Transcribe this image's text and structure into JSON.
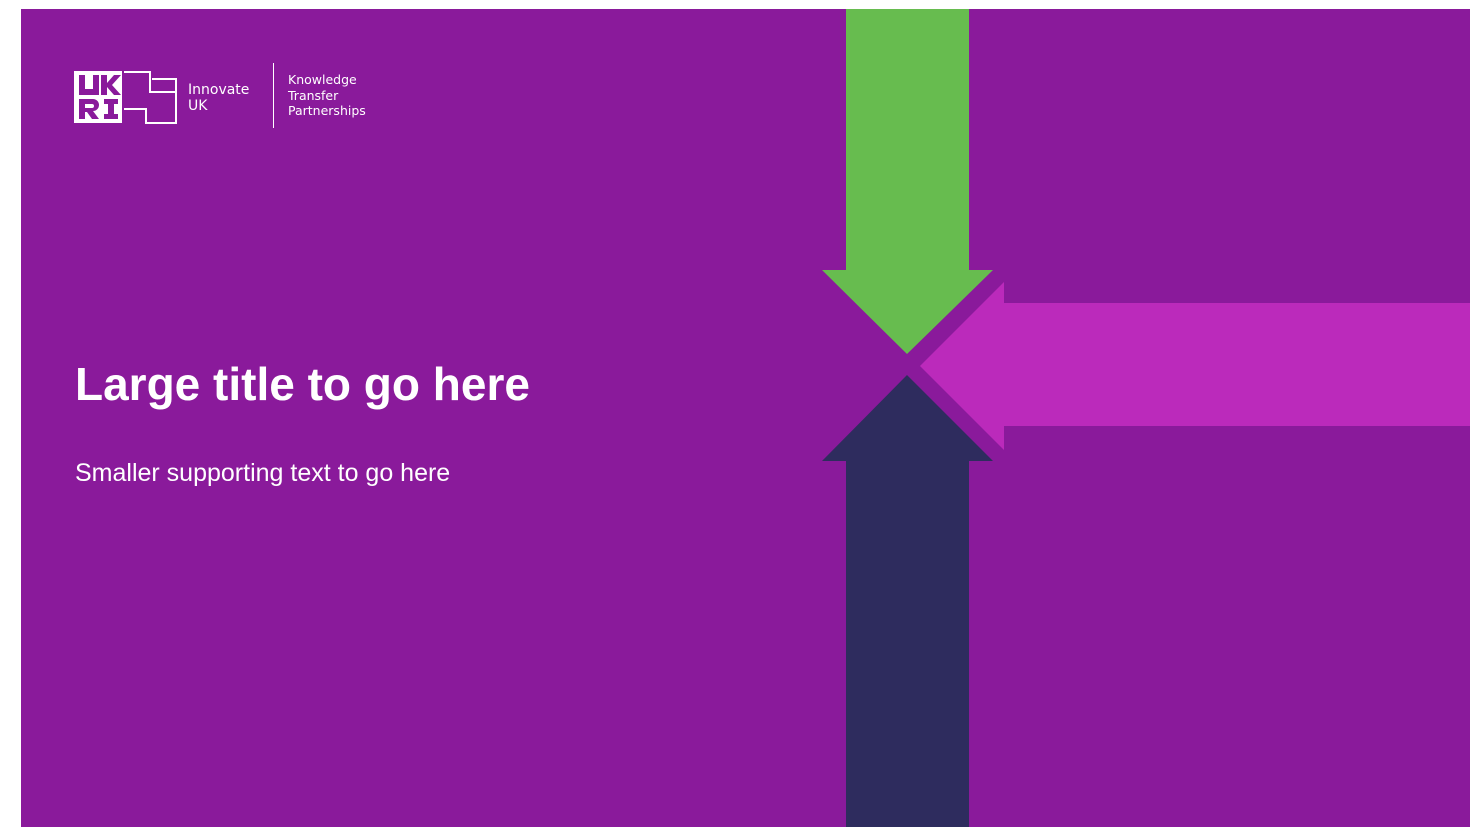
{
  "slide": {
    "title": "Large title to go here",
    "subtitle": "Smaller supporting text to go here"
  },
  "logo": {
    "mark_letters": "UKRI",
    "innovate_line1": "Innovate",
    "innovate_line2": "UK",
    "ktp_line1": "Knowledge",
    "ktp_line2": "Transfer",
    "ktp_line3": "Partnerships"
  },
  "colors": {
    "background": "#8a1a9b",
    "arrow_down": "#67bc4f",
    "arrow_left": "#bb2abb",
    "arrow_up": "#2e2c5e",
    "text": "#ffffff"
  },
  "icons": {
    "down_arrow": "arrow-down-icon",
    "left_arrow": "arrow-left-icon",
    "up_arrow": "arrow-up-icon"
  }
}
